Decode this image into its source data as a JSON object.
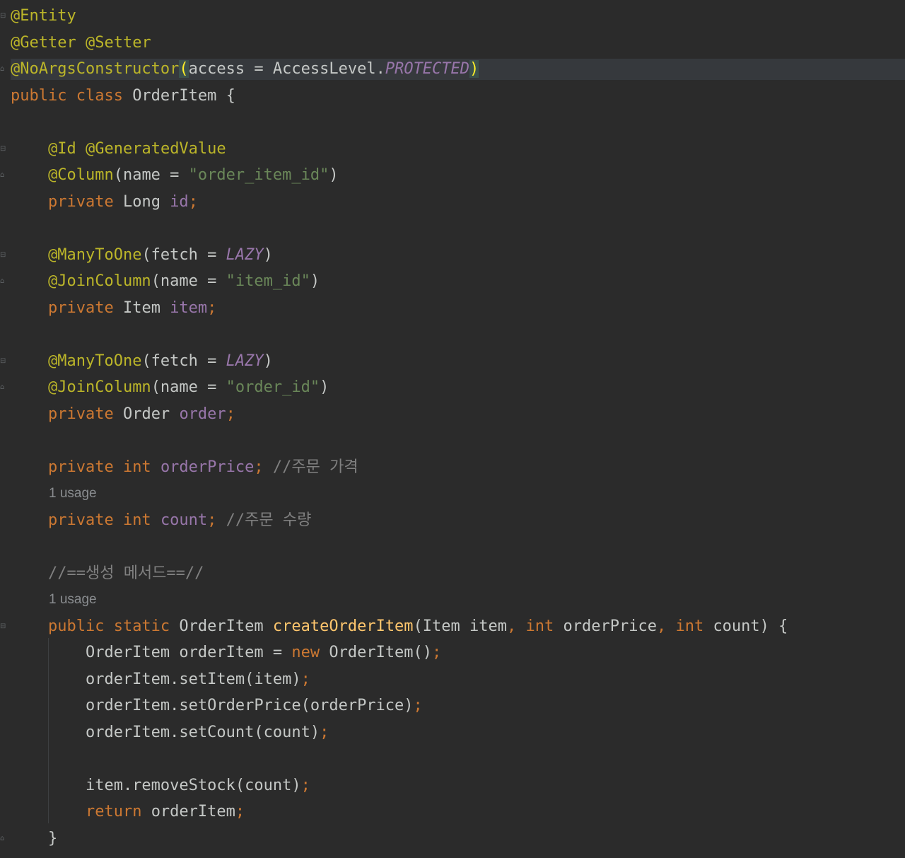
{
  "editor": {
    "colors": {
      "background": "#2b2b2b",
      "annotation": "#bbb529",
      "keyword": "#cc7832",
      "field": "#9876aa",
      "string": "#6a8759",
      "method": "#ffc66d",
      "comment": "#808080",
      "text": "#c5c8c6",
      "hint": "#8a8d90"
    },
    "lines": [
      {
        "tokens": [
          {
            "t": "@Entity",
            "c": "ann"
          }
        ]
      },
      {
        "tokens": [
          {
            "t": "@Getter",
            "c": "ann"
          },
          {
            "t": " "
          },
          {
            "t": "@Setter",
            "c": "ann"
          }
        ]
      },
      {
        "highlight": true,
        "tokens": [
          {
            "t": "@NoArgsConstructor",
            "c": "ann"
          },
          {
            "t": "(",
            "c": "bm"
          },
          {
            "t": "access = AccessLevel."
          },
          {
            "t": "PROTECTED",
            "c": "const"
          },
          {
            "t": ")",
            "c": "bm"
          }
        ]
      },
      {
        "tokens": [
          {
            "t": "public class ",
            "c": "kw"
          },
          {
            "t": "OrderItem {"
          }
        ]
      },
      {
        "tokens": []
      },
      {
        "tokens": [
          {
            "t": "    "
          },
          {
            "t": "@Id",
            "c": "ann"
          },
          {
            "t": " "
          },
          {
            "t": "@GeneratedValue",
            "c": "ann"
          }
        ]
      },
      {
        "tokens": [
          {
            "t": "    "
          },
          {
            "t": "@Column",
            "c": "ann"
          },
          {
            "t": "(name = "
          },
          {
            "t": "\"order_item_id\"",
            "c": "str"
          },
          {
            "t": ")"
          }
        ]
      },
      {
        "tokens": [
          {
            "t": "    "
          },
          {
            "t": "private ",
            "c": "kw"
          },
          {
            "t": "Long "
          },
          {
            "t": "id",
            "c": "fld"
          },
          {
            "t": ";",
            "c": "kw"
          }
        ]
      },
      {
        "tokens": []
      },
      {
        "tokens": [
          {
            "t": "    "
          },
          {
            "t": "@ManyToOne",
            "c": "ann"
          },
          {
            "t": "(fetch = "
          },
          {
            "t": "LAZY",
            "c": "const"
          },
          {
            "t": ")"
          }
        ]
      },
      {
        "tokens": [
          {
            "t": "    "
          },
          {
            "t": "@JoinColumn",
            "c": "ann"
          },
          {
            "t": "(name = "
          },
          {
            "t": "\"item_id\"",
            "c": "str"
          },
          {
            "t": ")"
          }
        ]
      },
      {
        "tokens": [
          {
            "t": "    "
          },
          {
            "t": "private ",
            "c": "kw"
          },
          {
            "t": "Item "
          },
          {
            "t": "item",
            "c": "fld"
          },
          {
            "t": ";",
            "c": "kw"
          }
        ]
      },
      {
        "tokens": []
      },
      {
        "tokens": [
          {
            "t": "    "
          },
          {
            "t": "@ManyToOne",
            "c": "ann"
          },
          {
            "t": "(fetch = "
          },
          {
            "t": "LAZY",
            "c": "const"
          },
          {
            "t": ")"
          }
        ]
      },
      {
        "tokens": [
          {
            "t": "    "
          },
          {
            "t": "@JoinColumn",
            "c": "ann"
          },
          {
            "t": "(name = "
          },
          {
            "t": "\"order_id\"",
            "c": "str"
          },
          {
            "t": ")"
          }
        ]
      },
      {
        "tokens": [
          {
            "t": "    "
          },
          {
            "t": "private ",
            "c": "kw"
          },
          {
            "t": "Order "
          },
          {
            "t": "order",
            "c": "fld"
          },
          {
            "t": ";",
            "c": "kw"
          }
        ]
      },
      {
        "tokens": []
      },
      {
        "tokens": [
          {
            "t": "    "
          },
          {
            "t": "private int ",
            "c": "kw"
          },
          {
            "t": "orderPrice",
            "c": "fld"
          },
          {
            "t": "; ",
            "c": "kw"
          },
          {
            "t": "//주문 가격",
            "c": "cmt"
          }
        ]
      },
      {
        "hint": "1 usage"
      },
      {
        "tokens": [
          {
            "t": "    "
          },
          {
            "t": "private int ",
            "c": "kw"
          },
          {
            "t": "count",
            "c": "fld"
          },
          {
            "t": "; ",
            "c": "kw"
          },
          {
            "t": "//주문 수량",
            "c": "cmt"
          }
        ]
      },
      {
        "tokens": []
      },
      {
        "tokens": [
          {
            "t": "    "
          },
          {
            "t": "//==생성 메서드==//",
            "c": "cmt"
          }
        ]
      },
      {
        "hint": "1 usage"
      },
      {
        "tokens": [
          {
            "t": "    "
          },
          {
            "t": "public static ",
            "c": "kw"
          },
          {
            "t": "OrderItem "
          },
          {
            "t": "createOrderItem",
            "c": "mth"
          },
          {
            "t": "(Item item"
          },
          {
            "t": ", ",
            "c": "kw"
          },
          {
            "t": "int ",
            "c": "kw"
          },
          {
            "t": "orderPrice"
          },
          {
            "t": ", ",
            "c": "kw"
          },
          {
            "t": "int ",
            "c": "kw"
          },
          {
            "t": "count) {"
          }
        ]
      },
      {
        "tokens": [
          {
            "t": "        OrderItem orderItem = "
          },
          {
            "t": "new ",
            "c": "kw"
          },
          {
            "t": "OrderItem()"
          },
          {
            "t": ";",
            "c": "kw"
          }
        ]
      },
      {
        "tokens": [
          {
            "t": "        orderItem.setItem(item)"
          },
          {
            "t": ";",
            "c": "kw"
          }
        ]
      },
      {
        "tokens": [
          {
            "t": "        orderItem.setOrderPrice(orderPrice)"
          },
          {
            "t": ";",
            "c": "kw"
          }
        ]
      },
      {
        "tokens": [
          {
            "t": "        orderItem.setCount(count)"
          },
          {
            "t": ";",
            "c": "kw"
          }
        ]
      },
      {
        "tokens": []
      },
      {
        "tokens": [
          {
            "t": "        item.removeStock(count)"
          },
          {
            "t": ";",
            "c": "kw"
          }
        ]
      },
      {
        "tokens": [
          {
            "t": "        "
          },
          {
            "t": "return ",
            "c": "kw"
          },
          {
            "t": "orderItem"
          },
          {
            "t": ";",
            "c": "kw"
          }
        ]
      },
      {
        "tokens": [
          {
            "t": "    }"
          }
        ]
      }
    ],
    "fold_markers": [
      {
        "line": 0,
        "icon": "fold-open-icon"
      },
      {
        "line": 2,
        "icon": "fold-close-icon"
      },
      {
        "line": 5,
        "icon": "fold-open-icon"
      },
      {
        "line": 6,
        "icon": "fold-close-icon"
      },
      {
        "line": 9,
        "icon": "fold-open-icon"
      },
      {
        "line": 10,
        "icon": "fold-close-icon"
      },
      {
        "line": 13,
        "icon": "fold-open-icon"
      },
      {
        "line": 14,
        "icon": "fold-close-icon"
      },
      {
        "line": 23,
        "icon": "fold-open-icon"
      },
      {
        "line": 31,
        "icon": "fold-close-icon"
      }
    ]
  }
}
